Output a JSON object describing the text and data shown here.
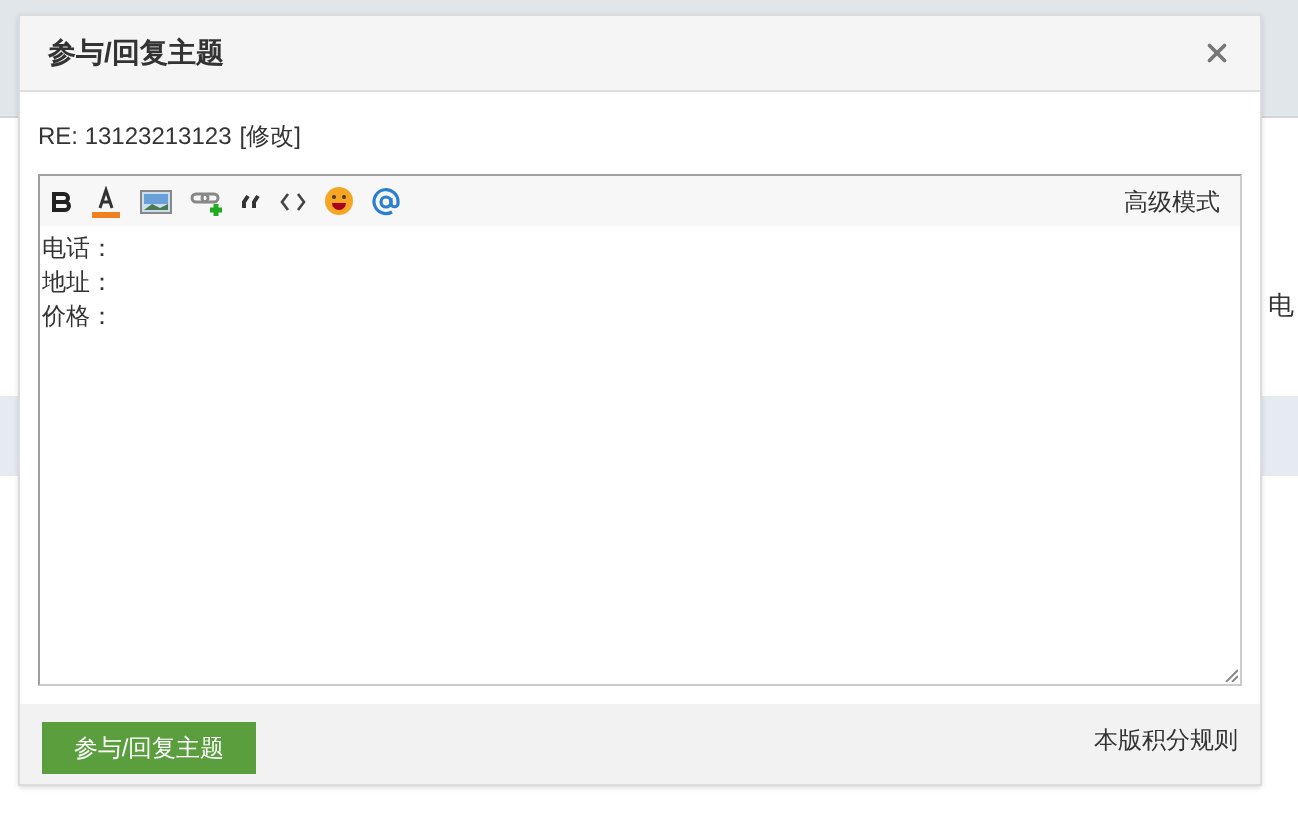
{
  "background": {
    "right_text": "电"
  },
  "dialog": {
    "title": "参与/回复主题",
    "subject": "RE: 13123213123",
    "edit_link": "[修改]",
    "toolbar": {
      "advanced_mode": "高级模式"
    },
    "editor": {
      "lines": [
        "电话：",
        "地址：",
        "价格："
      ]
    },
    "submit": "参与/回复主题",
    "rules_link": "本版积分规则"
  }
}
